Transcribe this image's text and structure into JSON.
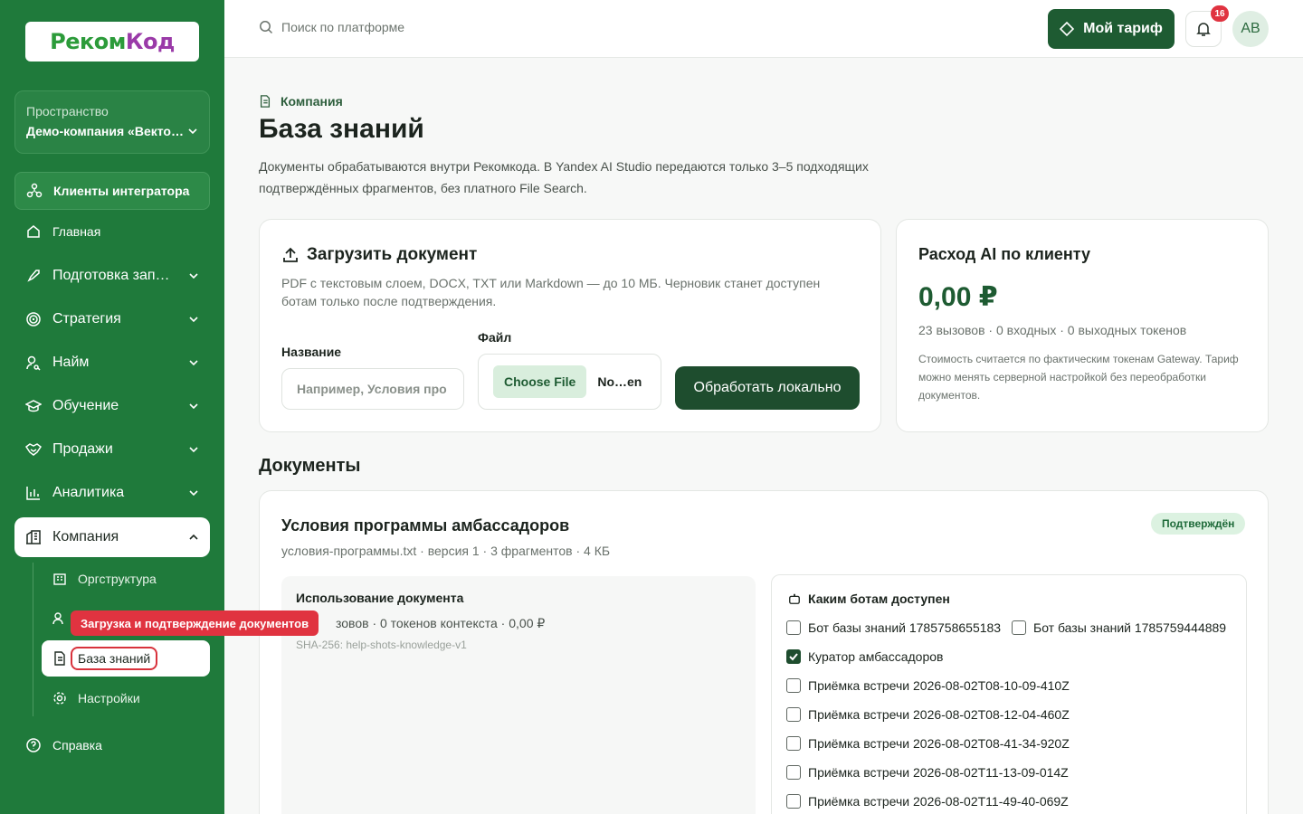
{
  "sidebar": {
    "logo": {
      "part1": "Реком",
      "part2": "Код"
    },
    "workspace": {
      "label": "Пространство",
      "name": "Демо-компания «Векто…"
    },
    "clients": "Клиенты интегратора",
    "nav": [
      {
        "label": "Главная",
        "icon": "home-icon"
      },
      {
        "label": "Подготовка зап…",
        "icon": "rocket-icon"
      },
      {
        "label": "Стратегия",
        "icon": "target-icon"
      },
      {
        "label": "Найм",
        "icon": "user-search-icon"
      },
      {
        "label": "Обучение",
        "icon": "graduation-cap-icon"
      },
      {
        "label": "Продажи",
        "icon": "handshake-icon"
      },
      {
        "label": "Аналитика",
        "icon": "bar-chart-icon"
      },
      {
        "label": "Компания",
        "icon": "building-icon"
      }
    ],
    "sub": [
      {
        "label": "Оргструктура",
        "icon": "org-icon"
      },
      {
        "label": "База знаний",
        "icon": "document-icon"
      },
      {
        "label": "Настройки",
        "icon": "gear-icon"
      }
    ],
    "help": "Справка",
    "tooltip": "Загрузка и подтверждение документов"
  },
  "topbar": {
    "search_placeholder": "Поиск по платформе",
    "plan_button": "Мой тариф",
    "notifications_count": "16",
    "avatar_initials": "AB"
  },
  "page": {
    "breadcrumb": "Компания",
    "title": "База знаний",
    "description": "Документы обрабатываются внутри Рекомкода. В Yandex AI Studio передаются только 3–5 подходящих подтверждённых фрагментов, без платного File Search."
  },
  "upload": {
    "title": "Загрузить документ",
    "hint": "PDF с текстовым слоем, DOCX, TXT или Markdown — до 10 МБ. Черновик станет доступен ботам только после подтверждения.",
    "name_label": "Название",
    "name_placeholder": "Например, Условия про",
    "file_label": "Файл",
    "choose_file": "Choose File",
    "file_name": "No…en",
    "process_button": "Обработать локально"
  },
  "spend": {
    "title": "Расход AI по клиенту",
    "amount": "0,00 ₽",
    "stats": "23 вызовов · 0 входных · 0 выходных токенов",
    "note": "Стоимость считается по фактическим токенам Gateway. Тариф можно менять серверной настройкой без переобработки документов."
  },
  "documents": {
    "title": "Документы",
    "items": [
      {
        "title": "Условия программы амбассадоров",
        "meta": "условия-программы.txt · версия 1 · 3 фрагментов · 4 КБ",
        "status": "Подтверждён",
        "usage_title": "Использование документа",
        "usage_stats": "зовов · 0 токенов контекста · 0,00 ₽",
        "hash": "SHA-256: help-shots-knowledge-v1",
        "bots_title": "Каким ботам доступен",
        "bots": [
          {
            "label": "Бот базы знаний 1785758655183",
            "checked": false
          },
          {
            "label": "Бот базы знаний 1785759444889",
            "checked": false
          },
          {
            "label": "Куратор амбассадоров",
            "checked": true
          },
          {
            "label": "Приёмка встречи 2026-08-02T08-10-09-410Z",
            "checked": false
          },
          {
            "label": "Приёмка встречи 2026-08-02T08-12-04-460Z",
            "checked": false
          },
          {
            "label": "Приёмка встречи 2026-08-02T08-41-34-920Z",
            "checked": false
          },
          {
            "label": "Приёмка встречи 2026-08-02T11-13-09-014Z",
            "checked": false
          },
          {
            "label": "Приёмка встречи 2026-08-02T11-49-40-069Z",
            "checked": false
          }
        ]
      }
    ]
  },
  "colors": {
    "sidebar": "#1f7a3b",
    "primary_dark": "#1e4d2e",
    "accent_red": "#e03340",
    "badge_green": "#dcf2e1"
  }
}
